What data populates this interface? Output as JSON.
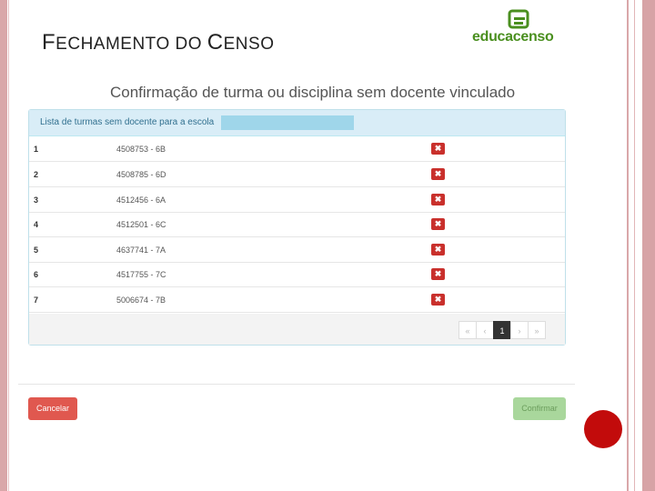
{
  "slide": {
    "title_first_initial": "F",
    "title_rest_1": "ECHAMENTO DO ",
    "title_second_initial": "C",
    "title_rest_2": "ENSO"
  },
  "logo": {
    "text": "educacenso",
    "color": "#4a8f1f"
  },
  "dialog": {
    "title": "Confirmação de turma ou disciplina sem docente vinculado",
    "panel_header": "Lista de turmas sem docente para a escola",
    "rows": [
      {
        "num": "1",
        "code": "4508753 - 6B"
      },
      {
        "num": "2",
        "code": "4508785 - 6D"
      },
      {
        "num": "3",
        "code": "4512456 - 6A"
      },
      {
        "num": "4",
        "code": "4512501 - 6C"
      },
      {
        "num": "5",
        "code": "4637741 - 7A"
      },
      {
        "num": "6",
        "code": "4517755 - 7C"
      },
      {
        "num": "7",
        "code": "5006674 - 7B"
      }
    ],
    "delete_glyph": "✖",
    "pagination": {
      "first": "«",
      "prev": "‹",
      "current": "1",
      "next": "›",
      "last": "»"
    },
    "cancel_label": "Cancelar",
    "confirm_label": "Confirmar"
  },
  "colors": {
    "cancel": "#e0584f",
    "confirm": "#a9d79c",
    "delete": "#c9302c",
    "header_bg": "#d9edf7",
    "decor_circle": "#c20b0b"
  }
}
